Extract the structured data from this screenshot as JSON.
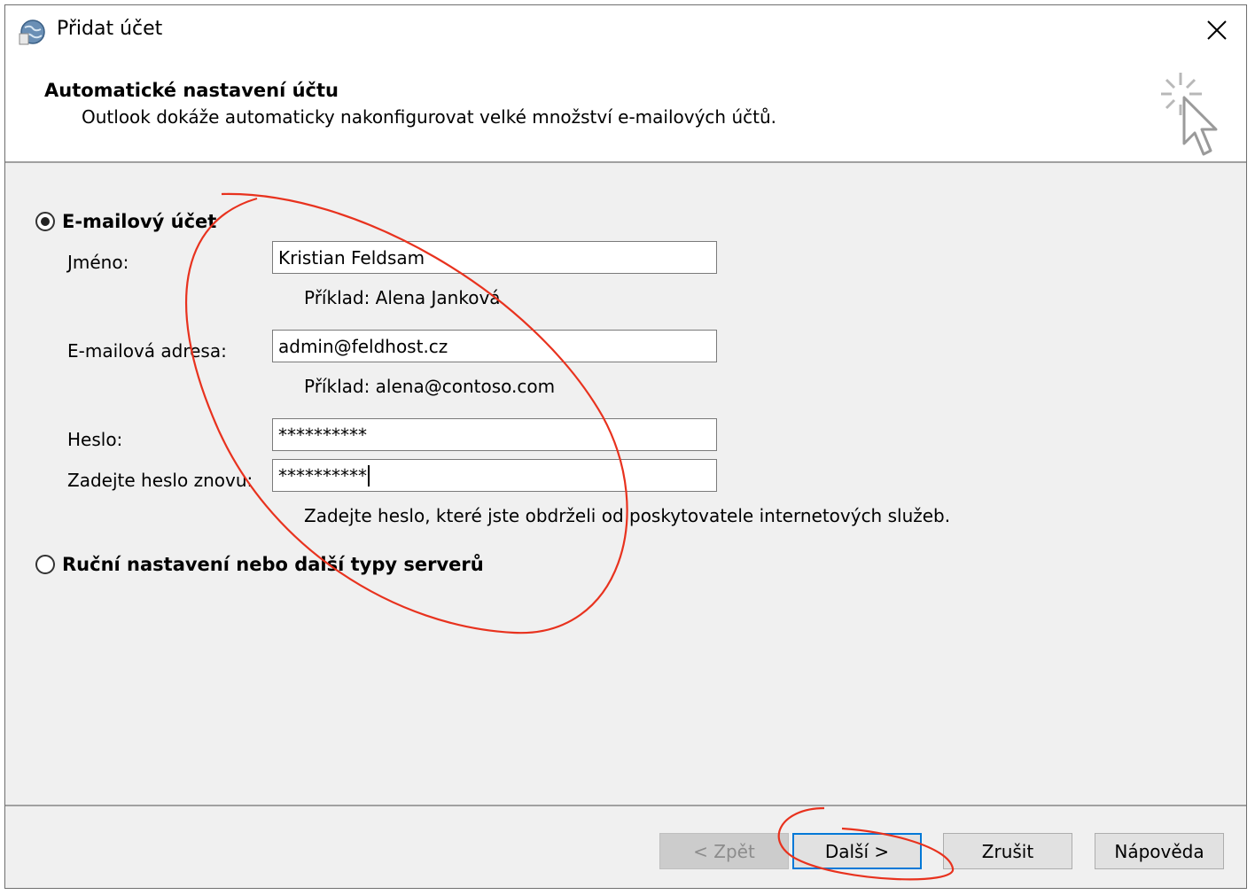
{
  "window": {
    "title": "Přidat účet"
  },
  "header": {
    "title": "Automatické nastavení účtu",
    "subtitle": "Outlook dokáže automaticky nakonfigurovat velké množství e-mailových účtů."
  },
  "form": {
    "email_account_option": "E-mailový účet",
    "name_label": "Jméno:",
    "name_value": "Kristian Feldsam",
    "name_example": "Příklad: Alena Janková",
    "email_label": "E-mailová adresa:",
    "email_value": "admin@feldhost.cz",
    "email_example": "Příklad: alena@contoso.com",
    "password_label": "Heslo:",
    "password_value": "**********",
    "password_repeat_label": "Zadejte heslo znovu:",
    "password_repeat_value": "**********",
    "password_hint": "Zadejte heslo, které jste obdrželi od poskytovatele internetových služeb.",
    "manual_option": "Ruční nastavení nebo další typy serverů"
  },
  "buttons": {
    "back": "< Zpět",
    "next": "Další >",
    "cancel": "Zrušit",
    "help": "Nápověda"
  },
  "colors": {
    "annotation": "#e8321e",
    "focus_border": "#0078d7"
  }
}
